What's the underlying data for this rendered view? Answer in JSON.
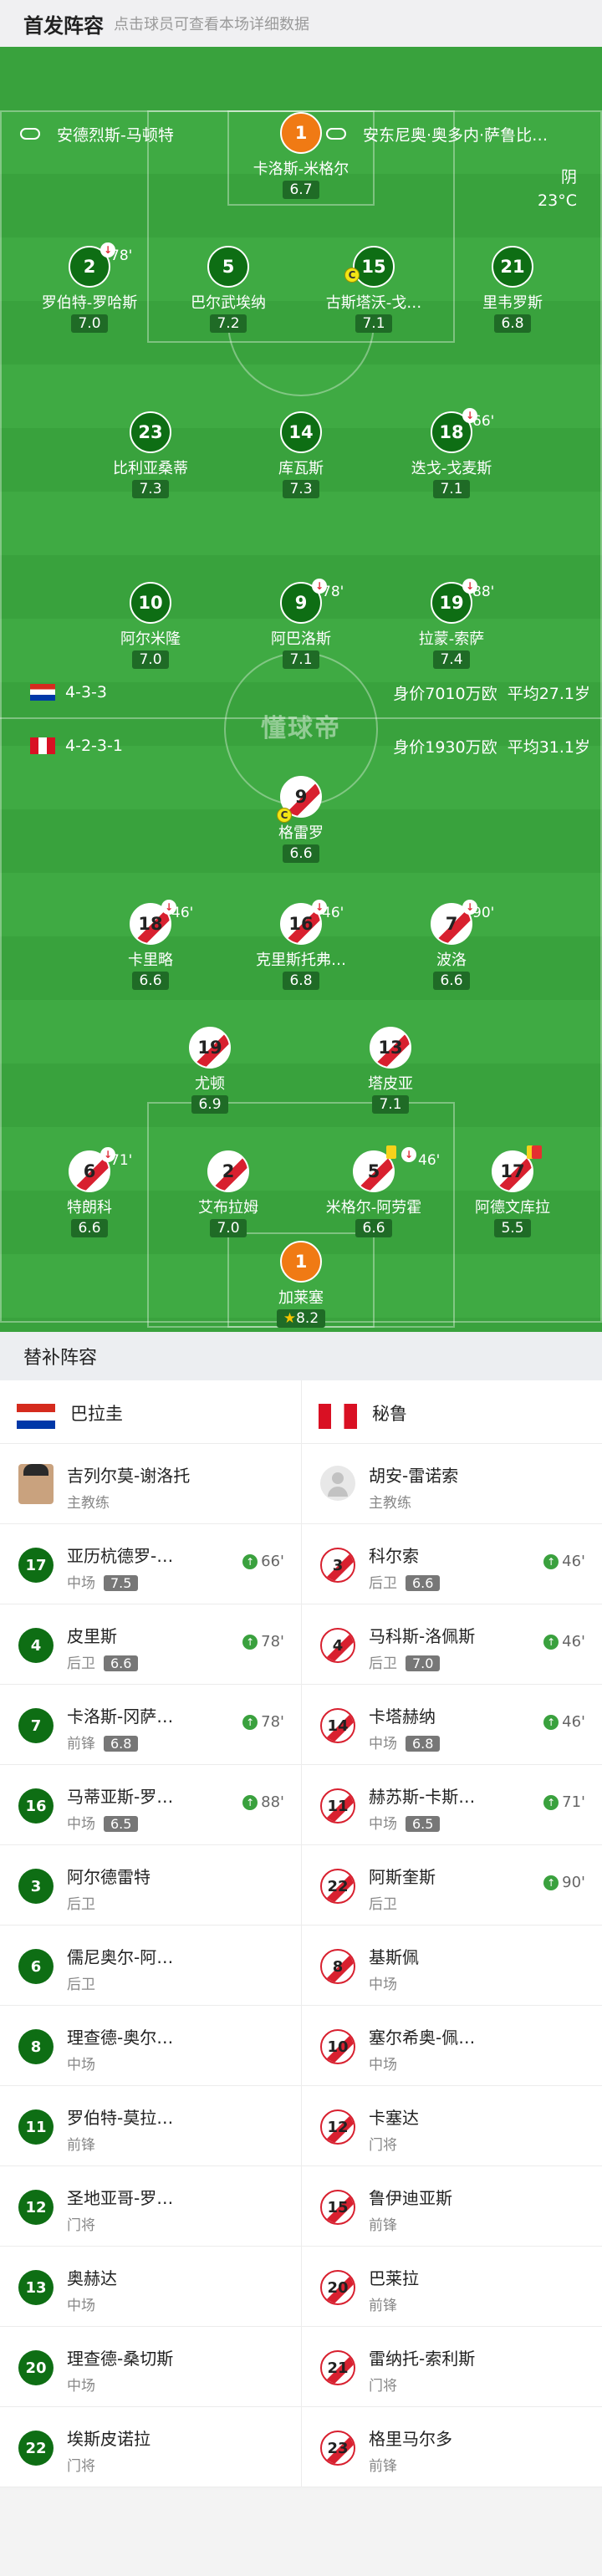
{
  "header": {
    "title": "首发阵容",
    "subtitle": "点击球员可查看本场详细数据"
  },
  "match": {
    "home_coach_label": "安德烈斯-马顿特",
    "away_coach_label": "安东尼奥·奥多内·萨鲁比…",
    "weather": "阴",
    "temperature": "23°C",
    "watermark": "懂球帝"
  },
  "paraguay": {
    "formation": "4-3-3",
    "value": "身价7010万欧",
    "age": "平均27.1岁"
  },
  "peru": {
    "formation": "4-2-3-1",
    "value": "身价1930万欧",
    "age": "平均31.1岁"
  },
  "home_players": [
    {
      "num": "1",
      "name": "卡洛斯-米格尔",
      "rating": "6.7",
      "minute": ""
    },
    {
      "num": "2",
      "name": "罗伯特-罗哈斯",
      "rating": "7.0",
      "minute": "78'"
    },
    {
      "num": "5",
      "name": "巴尔武埃纳",
      "rating": "7.2",
      "minute": ""
    },
    {
      "num": "15",
      "name": "古斯塔沃-戈…",
      "rating": "7.1",
      "minute": ""
    },
    {
      "num": "21",
      "name": "里韦罗斯",
      "rating": "6.8",
      "minute": ""
    },
    {
      "num": "23",
      "name": "比利亚桑蒂",
      "rating": "7.3",
      "minute": ""
    },
    {
      "num": "14",
      "name": "库瓦斯",
      "rating": "7.3",
      "minute": ""
    },
    {
      "num": "18",
      "name": "迭戈-戈麦斯",
      "rating": "7.1",
      "minute": "66'"
    },
    {
      "num": "10",
      "name": "阿尔米隆",
      "rating": "7.0",
      "minute": ""
    },
    {
      "num": "9",
      "name": "阿巴洛斯",
      "rating": "7.1",
      "minute": "78'"
    },
    {
      "num": "19",
      "name": "拉蒙-索萨",
      "rating": "7.4",
      "minute": "88'"
    }
  ],
  "away_players": [
    {
      "num": "9",
      "name": "格雷罗",
      "rating": "6.6",
      "minute": ""
    },
    {
      "num": "18",
      "name": "卡里略",
      "rating": "6.6",
      "minute": "46'"
    },
    {
      "num": "16",
      "name": "克里斯托弗…",
      "rating": "6.8",
      "minute": "46'"
    },
    {
      "num": "7",
      "name": "波洛",
      "rating": "6.6",
      "minute": "90'"
    },
    {
      "num": "19",
      "name": "尤顿",
      "rating": "6.9",
      "minute": ""
    },
    {
      "num": "13",
      "name": "塔皮亚",
      "rating": "7.1",
      "minute": ""
    },
    {
      "num": "6",
      "name": "特朗科",
      "rating": "6.6",
      "minute": "71'"
    },
    {
      "num": "2",
      "name": "艾布拉姆",
      "rating": "7.0",
      "minute": ""
    },
    {
      "num": "5",
      "name": "米格尔-阿劳霍",
      "rating": "6.6",
      "minute": "46'"
    },
    {
      "num": "17",
      "name": "阿德文库拉",
      "rating": "5.5",
      "minute": ""
    },
    {
      "num": "1",
      "name": "加莱塞",
      "rating": "8.2",
      "minute": ""
    }
  ],
  "subs": {
    "title": "替补阵容",
    "home_team": "巴拉圭",
    "away_team": "秘鲁",
    "home_coach": {
      "name": "吉列尔莫-谢洛托",
      "role": "主教练"
    },
    "away_coach": {
      "name": "胡安-雷诺索",
      "role": "主教练"
    },
    "home": [
      {
        "num": "17",
        "name": "亚历杭德罗-…",
        "pos": "中场",
        "rating": "7.5",
        "sub": "66'"
      },
      {
        "num": "4",
        "name": "皮里斯",
        "pos": "后卫",
        "rating": "6.6",
        "sub": "78'"
      },
      {
        "num": "7",
        "name": "卡洛斯-冈萨…",
        "pos": "前锋",
        "rating": "6.8",
        "sub": "78'"
      },
      {
        "num": "16",
        "name": "马蒂亚斯-罗…",
        "pos": "中场",
        "rating": "6.5",
        "sub": "88'"
      },
      {
        "num": "3",
        "name": "阿尔德雷特",
        "pos": "后卫",
        "rating": "",
        "sub": ""
      },
      {
        "num": "6",
        "name": "儒尼奥尔-阿…",
        "pos": "后卫",
        "rating": "",
        "sub": ""
      },
      {
        "num": "8",
        "name": "理查德-奥尔…",
        "pos": "中场",
        "rating": "",
        "sub": ""
      },
      {
        "num": "11",
        "name": "罗伯特-莫拉…",
        "pos": "前锋",
        "rating": "",
        "sub": ""
      },
      {
        "num": "12",
        "name": "圣地亚哥-罗…",
        "pos": "门将",
        "rating": "",
        "sub": ""
      },
      {
        "num": "13",
        "name": "奥赫达",
        "pos": "中场",
        "rating": "",
        "sub": ""
      },
      {
        "num": "20",
        "name": "理查德-桑切斯",
        "pos": "中场",
        "rating": "",
        "sub": ""
      },
      {
        "num": "22",
        "name": "埃斯皮诺拉",
        "pos": "门将",
        "rating": "",
        "sub": ""
      }
    ],
    "away": [
      {
        "num": "3",
        "name": "科尔索",
        "pos": "后卫",
        "rating": "6.6",
        "sub": "46'"
      },
      {
        "num": "4",
        "name": "马科斯-洛佩斯",
        "pos": "后卫",
        "rating": "7.0",
        "sub": "46'"
      },
      {
        "num": "14",
        "name": "卡塔赫纳",
        "pos": "中场",
        "rating": "6.8",
        "sub": "46'"
      },
      {
        "num": "11",
        "name": "赫苏斯-卡斯…",
        "pos": "中场",
        "rating": "6.5",
        "sub": "71'"
      },
      {
        "num": "22",
        "name": "阿斯奎斯",
        "pos": "后卫",
        "rating": "",
        "sub": "90'"
      },
      {
        "num": "8",
        "name": "基斯佩",
        "pos": "中场",
        "rating": "",
        "sub": ""
      },
      {
        "num": "10",
        "name": "塞尔希奥-佩…",
        "pos": "中场",
        "rating": "",
        "sub": ""
      },
      {
        "num": "12",
        "name": "卡塞达",
        "pos": "门将",
        "rating": "",
        "sub": ""
      },
      {
        "num": "15",
        "name": "鲁伊迪亚斯",
        "pos": "前锋",
        "rating": "",
        "sub": ""
      },
      {
        "num": "20",
        "name": "巴莱拉",
        "pos": "前锋",
        "rating": "",
        "sub": ""
      },
      {
        "num": "21",
        "name": "雷纳托-索利斯",
        "pos": "门将",
        "rating": "",
        "sub": ""
      },
      {
        "num": "23",
        "name": "格里马尔多",
        "pos": "前锋",
        "rating": "",
        "sub": ""
      }
    ]
  }
}
